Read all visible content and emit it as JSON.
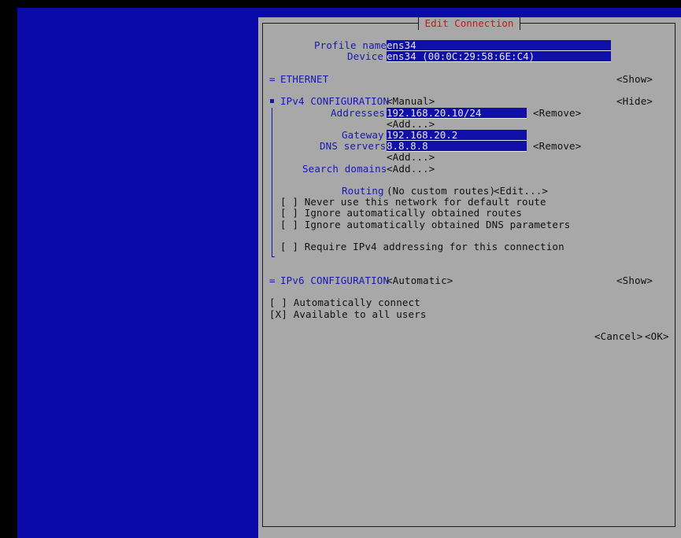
{
  "dialog": {
    "title": "Edit Connection",
    "profile_name_label": "Profile name",
    "profile_name_value": "ens34",
    "device_label": "Device",
    "device_value": "ens34 (00:0C:29:58:6E:C4)"
  },
  "ethernet": {
    "marker": "=",
    "label": "ETHERNET",
    "toggle": "<Show>"
  },
  "ipv4": {
    "label": "IPv4 CONFIGURATION",
    "method": "<Manual>",
    "toggle": "<Hide>",
    "addresses_label": "Addresses",
    "address_value": "192.168.20.10/24",
    "address_remove": "<Remove>",
    "address_add": "<Add...>",
    "gateway_label": "Gateway",
    "gateway_value": "192.168.20.2",
    "dns_label": "DNS servers",
    "dns_value": "8.8.8.8",
    "dns_remove": "<Remove>",
    "dns_add": "<Add...>",
    "search_label": "Search domains",
    "search_add": "<Add...>",
    "routing_label": "Routing",
    "routing_value": "(No custom routes)",
    "routing_edit": "<Edit...>",
    "checkbox_never_default": "[ ] Never use this network for default route",
    "checkbox_ignore_routes": "[ ] Ignore automatically obtained routes",
    "checkbox_ignore_dns": "[ ] Ignore automatically obtained DNS parameters",
    "checkbox_require": "[ ] Require IPv4 addressing for this connection"
  },
  "ipv6": {
    "marker": "=",
    "label": "IPv6 CONFIGURATION",
    "method": "<Automatic>",
    "toggle": "<Show>"
  },
  "options": {
    "auto_connect": "[ ] Automatically connect",
    "all_users": "[X] Available to all users"
  },
  "buttons": {
    "cancel": "<Cancel>",
    "ok": "<OK>"
  },
  "colors": {
    "desktop": "#0a0aa8",
    "dialog": "#a8a8a8",
    "field": "#1010a8",
    "label": "#1818b0",
    "title": "#c81818"
  }
}
